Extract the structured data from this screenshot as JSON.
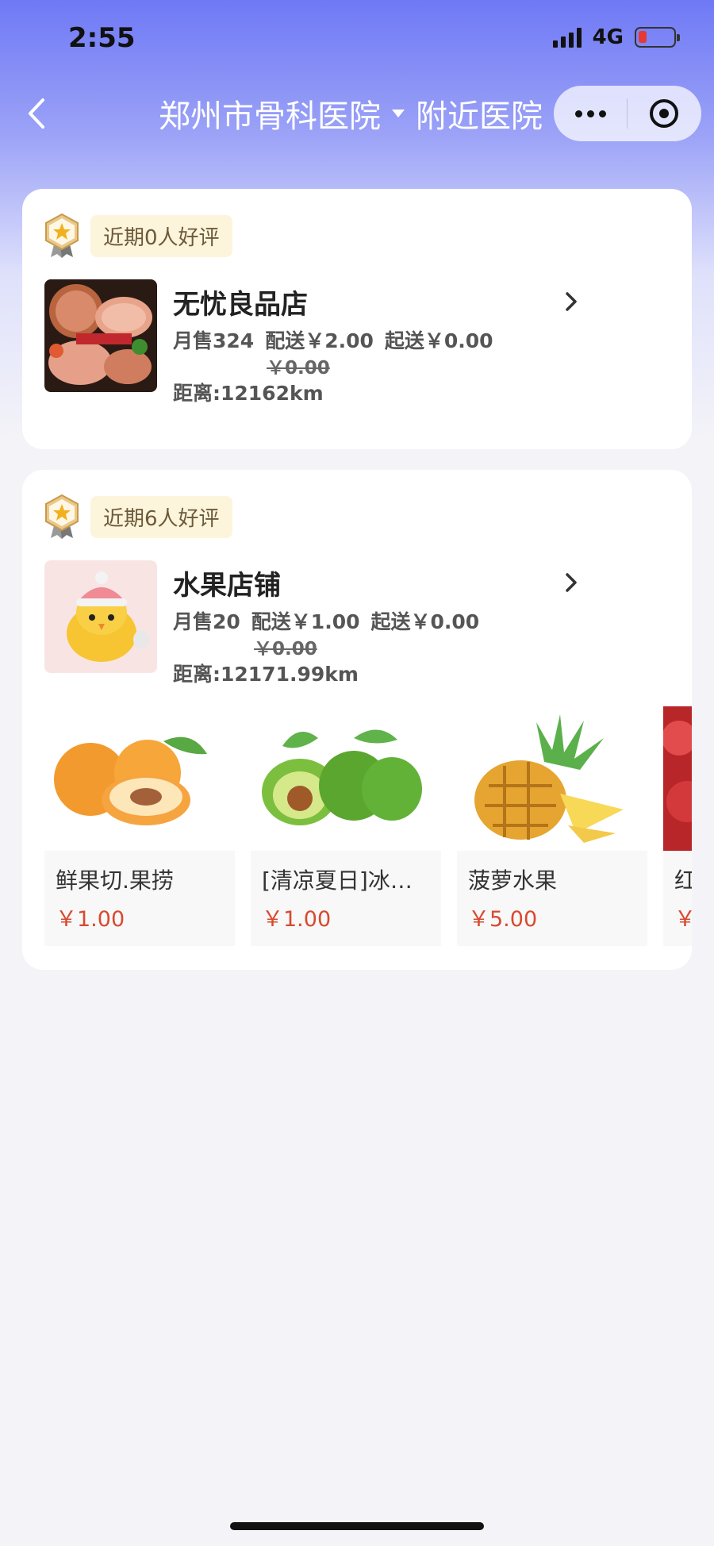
{
  "status_bar": {
    "time": "2:55",
    "network": "4G"
  },
  "nav": {
    "title_location": "郑州市骨科医院",
    "title_suffix": "附近医院"
  },
  "stores": [
    {
      "review_tag": "近期0人好评",
      "name": "无忧良品店",
      "sales": "月售324",
      "delivery": "配送￥2.00",
      "min_order": "起送￥0.00",
      "original_delivery": "￥0.00",
      "distance": "距离:12162km"
    },
    {
      "review_tag": "近期6人好评",
      "name": "水果店铺",
      "sales": "月售20",
      "delivery": "配送￥1.00",
      "min_order": "起送￥0.00",
      "original_delivery": "￥0.00",
      "distance": "距离:12171.99km",
      "products": [
        {
          "name": "鲜果切.果捞",
          "price": "￥1.00"
        },
        {
          "name": "[清凉夏日]冰…",
          "price": "￥1.00"
        },
        {
          "name": "菠萝水果",
          "price": "￥5.00"
        },
        {
          "name": "红",
          "price": "￥"
        }
      ]
    }
  ],
  "colors": {
    "accent_price": "#d8492f",
    "nav_gradient_top": "#6f79f5"
  }
}
